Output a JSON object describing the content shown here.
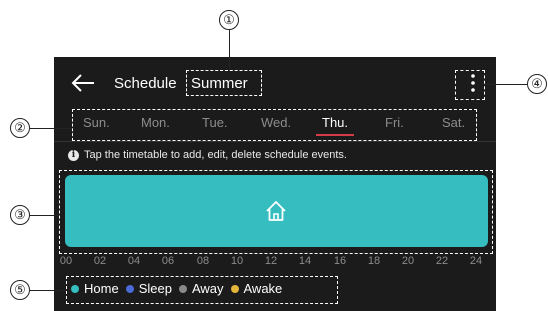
{
  "header": {
    "title": "Schedule",
    "schedule_name": "Summer",
    "back_icon": "arrow-left-icon",
    "menu_icon": "more-vertical-icon"
  },
  "days": [
    {
      "label": "Sun.",
      "active": false
    },
    {
      "label": "Mon.",
      "active": false
    },
    {
      "label": "Tue.",
      "active": false
    },
    {
      "label": "Wed.",
      "active": false
    },
    {
      "label": "Thu.",
      "active": true
    },
    {
      "label": "Fri.",
      "active": false
    },
    {
      "label": "Sat.",
      "active": false
    }
  ],
  "info": {
    "icon": "info-icon",
    "text": "Tap the timetable to add, edit, delete schedule events."
  },
  "timetable": {
    "event_icon": "home-icon",
    "color": "#35bdbf"
  },
  "hours": [
    "00",
    "02",
    "04",
    "06",
    "08",
    "10",
    "12",
    "14",
    "16",
    "18",
    "20",
    "22",
    "24"
  ],
  "legend": [
    {
      "label": "Home",
      "color": "#35bdbf"
    },
    {
      "label": "Sleep",
      "color": "#4a6ad8"
    },
    {
      "label": "Away",
      "color": "#8a8a8a"
    },
    {
      "label": "Awake",
      "color": "#e3b53a"
    }
  ],
  "callouts": [
    "①",
    "②",
    "③",
    "④",
    "⑤"
  ],
  "colors": {
    "background": "#1b1b1b",
    "active_underline": "#d63b48"
  }
}
